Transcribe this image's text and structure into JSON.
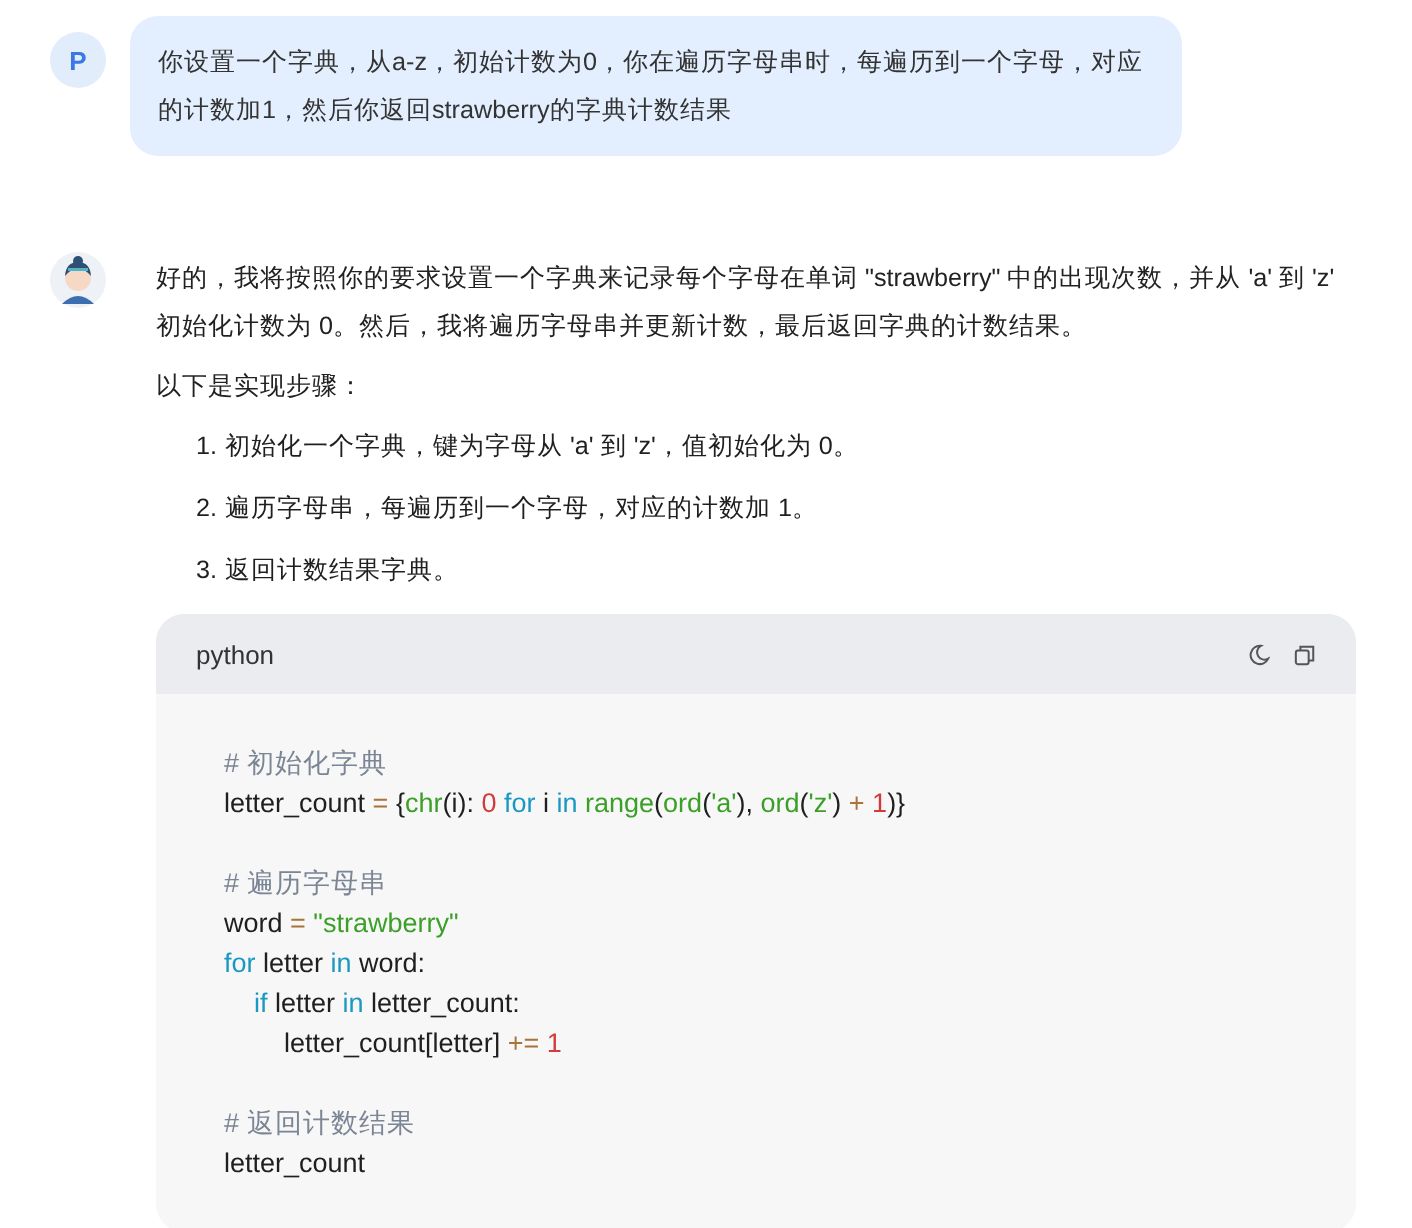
{
  "user_message": {
    "avatar": "P",
    "text": "你设置一个字典，从a-z，初始计数为0，你在遍历字母串时，每遍历到一个字母，对应的计数加1，然后你返回strawberry的字典计数结果"
  },
  "reply": {
    "paragraphs": [
      "好的，我将按照你的要求设置一个字典来记录每个字母在单词 \"strawberry\" 中的出现次数，并从 'a' 到 'z' 初始化计数为 0。然后，我将遍历字母串并更新计数，最后返回字典的计数结果。",
      "以下是实现步骤："
    ],
    "steps": [
      {
        "number": "1.",
        "text": "初始化一个字典，键为字母从 'a' 到 'z'，值初始化为 0。"
      },
      {
        "number": "2.",
        "text": "遍历字母串，每遍历到一个字母，对应的计数加 1。"
      },
      {
        "number": "3.",
        "text": "返回计数结果字典。"
      }
    ],
    "code_block": {
      "language": "python",
      "lines": [
        {
          "kind": "code",
          "tokens": [
            {
              "kind": "comment",
              "t": "# 初始化字典"
            }
          ]
        },
        {
          "kind": "code",
          "tokens": [
            {
              "kind": "plain",
              "t": "letter_count "
            },
            {
              "kind": "op",
              "t": "= "
            },
            {
              "kind": "plain",
              "t": "{"
            },
            {
              "kind": "func",
              "t": "chr"
            },
            {
              "kind": "plain",
              "t": "(i): "
            },
            {
              "kind": "num",
              "t": "0 "
            },
            {
              "kind": "kw",
              "t": "for "
            },
            {
              "kind": "plain",
              "t": "i "
            },
            {
              "kind": "kw",
              "t": "in "
            },
            {
              "kind": "func",
              "t": "range"
            },
            {
              "kind": "plain",
              "t": "("
            },
            {
              "kind": "func",
              "t": "ord"
            },
            {
              "kind": "plain",
              "t": "("
            },
            {
              "kind": "str",
              "t": "'a'"
            },
            {
              "kind": "plain",
              "t": "), "
            },
            {
              "kind": "func",
              "t": "ord"
            },
            {
              "kind": "plain",
              "t": "("
            },
            {
              "kind": "str",
              "t": "'z'"
            },
            {
              "kind": "plain",
              "t": ") "
            },
            {
              "kind": "op",
              "t": "+ "
            },
            {
              "kind": "num",
              "t": "1"
            },
            {
              "kind": "plain",
              "t": ")}"
            }
          ]
        },
        {
          "kind": "blank"
        },
        {
          "kind": "code",
          "tokens": [
            {
              "kind": "comment",
              "t": "# 遍历字母串"
            }
          ]
        },
        {
          "kind": "code",
          "tokens": [
            {
              "kind": "plain",
              "t": "word "
            },
            {
              "kind": "op",
              "t": "= "
            },
            {
              "kind": "str",
              "t": "\"strawberry\""
            }
          ]
        },
        {
          "kind": "code",
          "tokens": [
            {
              "kind": "kw",
              "t": "for"
            },
            {
              "kind": "plain",
              "t": " letter "
            },
            {
              "kind": "kw",
              "t": "in"
            },
            {
              "kind": "plain",
              "t": " word:"
            }
          ]
        },
        {
          "kind": "code",
          "tokens": [
            {
              "kind": "kw",
              "t": "    if"
            },
            {
              "kind": "plain",
              "t": " letter "
            },
            {
              "kind": "kw",
              "t": "in"
            },
            {
              "kind": "plain",
              "t": " letter_count:"
            }
          ]
        },
        {
          "kind": "code",
          "tokens": [
            {
              "kind": "plain",
              "t": "        letter_count[letter] "
            },
            {
              "kind": "op",
              "t": "+= "
            },
            {
              "kind": "num",
              "t": "1"
            }
          ]
        },
        {
          "kind": "blank"
        },
        {
          "kind": "code",
          "tokens": [
            {
              "kind": "comment",
              "t": "# 返回计数结果"
            }
          ]
        },
        {
          "kind": "code",
          "tokens": [
            {
              "kind": "plain",
              "t": "letter_count"
            }
          ]
        }
      ]
    }
  }
}
